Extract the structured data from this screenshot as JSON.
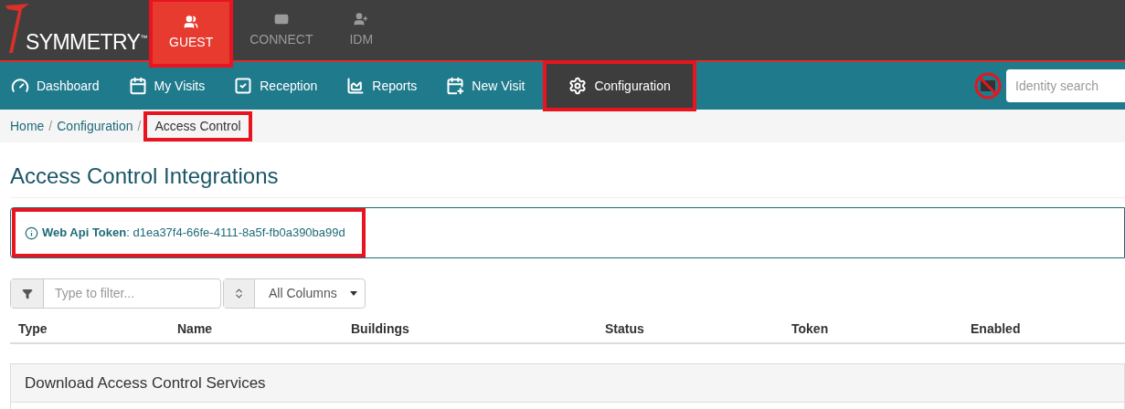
{
  "logo": {
    "text": "SYMMETRY",
    "mark": "™"
  },
  "modules": [
    {
      "label": "GUEST",
      "kind": "guest",
      "selected": true,
      "highlighted": true
    },
    {
      "label": "CONNECT",
      "kind": "connect",
      "selected": false,
      "highlighted": false
    },
    {
      "label": "IDM",
      "kind": "idm",
      "selected": false,
      "highlighted": false
    }
  ],
  "nav": [
    {
      "label": "Dashboard",
      "kind": "dashboard",
      "selected": false,
      "highlighted": false
    },
    {
      "label": "My Visits",
      "kind": "visits",
      "selected": false,
      "highlighted": false
    },
    {
      "label": "Reception",
      "kind": "reception",
      "selected": false,
      "highlighted": false
    },
    {
      "label": "Reports",
      "kind": "reports",
      "selected": false,
      "highlighted": false
    },
    {
      "label": "New Visit",
      "kind": "newvisit",
      "selected": false,
      "highlighted": false
    },
    {
      "label": "Configuration",
      "kind": "config",
      "selected": true,
      "highlighted": true
    }
  ],
  "search": {
    "placeholder": "Identity search"
  },
  "breadcrumb": [
    {
      "label": "Home",
      "current": false,
      "highlighted": false
    },
    {
      "label": "Configuration",
      "current": false,
      "highlighted": false
    },
    {
      "label": "Access Control",
      "current": true,
      "highlighted": true
    }
  ],
  "breadcrumb_separators": [
    "/",
    "/"
  ],
  "title": "Access Control Integrations",
  "token": {
    "label": "Web Api Token",
    "separator": ":",
    "value": "d1ea37f4-66fe-4111-8a5f-fb0a390ba99d",
    "highlighted": true
  },
  "filter": {
    "placeholder": "Type to filter...",
    "column": "All Columns"
  },
  "table": {
    "columns": [
      "Type",
      "Name",
      "Buildings",
      "Status",
      "Token",
      "Enabled"
    ]
  },
  "panel": {
    "title": "Download Access Control Services"
  }
}
